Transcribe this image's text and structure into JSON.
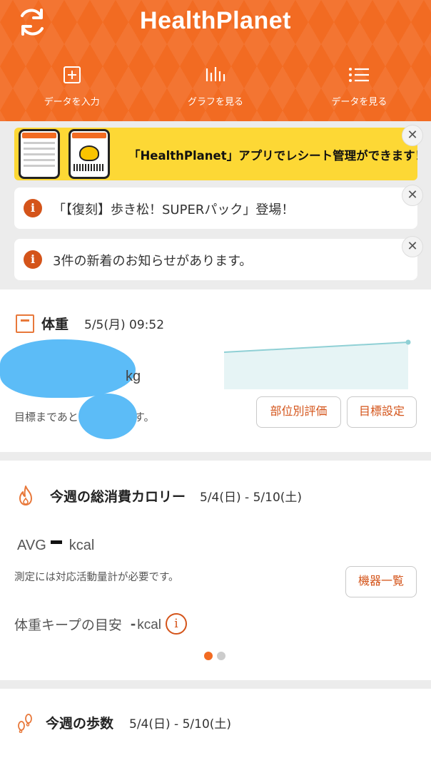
{
  "header": {
    "logo": "HealthPlanet",
    "nav": [
      {
        "label": "データを入力"
      },
      {
        "label": "グラフを見る"
      },
      {
        "label": "データを見る"
      }
    ]
  },
  "banner": {
    "text": "「HealthPlanet」アプリでレシート管理ができます！"
  },
  "notices": [
    {
      "text": "「【復刻】歩き松！SUPERパック」登場！"
    },
    {
      "text": "3件の新着のお知らせがあります。"
    }
  ],
  "weight": {
    "title": "体重",
    "date": "5/5(月) 09:52",
    "unit": "kg",
    "goal_text": "目標まであと　　　kgです。",
    "buttons": {
      "part_eval": "部位別評価",
      "goal_setting": "目標設定"
    }
  },
  "calories": {
    "title": "今週の総消費カロリー",
    "range": "5/4(日) - 5/10(土)",
    "avg_label": "AVG",
    "avg_unit": "kcal",
    "requirement": "測定には対応活動量計が必要です。",
    "device_button": "機器一覧",
    "keep_label": "体重キープの目安",
    "keep_value": "-",
    "keep_unit": "kcal",
    "info_glyph": "i",
    "pages": 2,
    "active_page": 1
  },
  "steps": {
    "title": "今週の歩数",
    "range": "5/4(日) - 5/10(土)"
  },
  "colors": {
    "brand": "#f26b22",
    "accent": "#d4541a",
    "banner_bg": "#fdd835",
    "chart_line": "#8fd0d5"
  },
  "icons": [
    "sync-icon",
    "plus-square-icon",
    "bar-graph-icon",
    "list-icon",
    "close-icon",
    "info-icon",
    "scale-icon",
    "flame-icon",
    "footsteps-icon"
  ]
}
